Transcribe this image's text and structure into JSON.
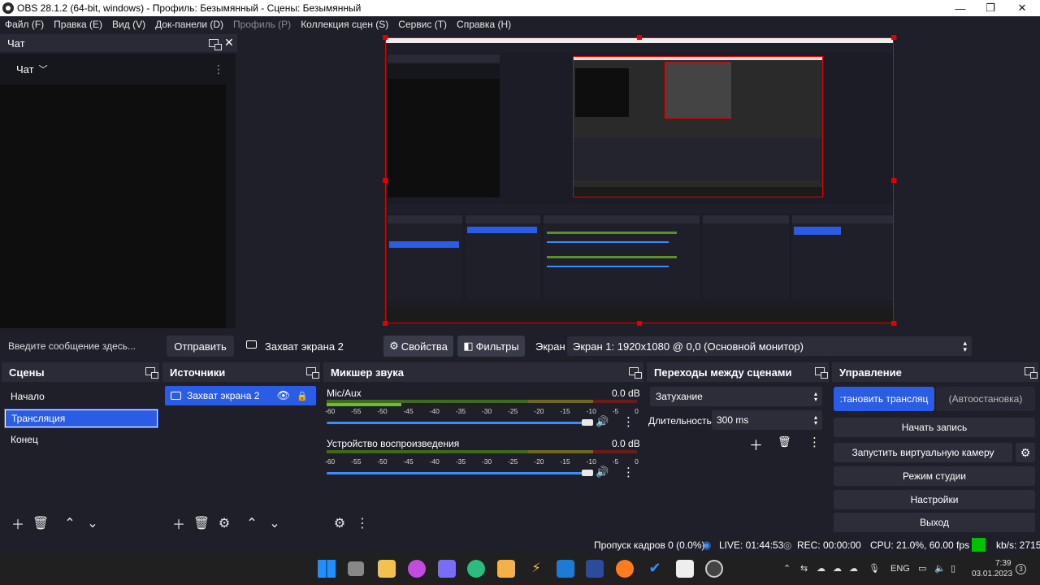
{
  "window": {
    "title": "OBS 28.1.2 (64-bit, windows) - Профиль: Безымянный - Сцены: Безымянный",
    "minimize_icon": "minimize-icon",
    "maximize_icon": "maximize-icon",
    "close_icon": "close-icon"
  },
  "menu": {
    "items": [
      {
        "label": "Файл (F)",
        "enabled": true
      },
      {
        "label": "Правка (E)",
        "enabled": true
      },
      {
        "label": "Вид (V)",
        "enabled": true
      },
      {
        "label": "Док-панели (D)",
        "enabled": true
      },
      {
        "label": "Профиль (P)",
        "enabled": false
      },
      {
        "label": "Коллекция сцен (S)",
        "enabled": true
      },
      {
        "label": "Сервис (T)",
        "enabled": true
      },
      {
        "label": "Справка (H)",
        "enabled": true
      }
    ]
  },
  "chat": {
    "dock_title": "Чат",
    "selector_label": "Чат",
    "input_placeholder": "Введите сообщение здесь...",
    "send_label": "Отправить"
  },
  "source_bar": {
    "source_name": "Захват экрана 2",
    "properties_label": "Свойства",
    "filters_label": "Фильтры",
    "display_label": "Экран",
    "display_value": "Экран 1: 1920x1080 @ 0,0 (Основной монитор)"
  },
  "scenes": {
    "title": "Сцены",
    "items": [
      "Начало",
      "Трансляция",
      "Конец"
    ],
    "selected_index": 1
  },
  "sources": {
    "title": "Источники",
    "items": [
      {
        "name": "Захват экрана 2",
        "visible": true,
        "locked": false
      }
    ]
  },
  "mixer": {
    "title": "Микшер звука",
    "ticks": [
      "-60",
      "-55",
      "-50",
      "-45",
      "-40",
      "-35",
      "-30",
      "-25",
      "-20",
      "-15",
      "-10",
      "-5",
      "0"
    ],
    "channels": [
      {
        "name": "Mic/Aux",
        "db": "0.0 dB",
        "volume": 0.98
      },
      {
        "name": "Устройство воспроизведения",
        "db": "0.0 dB",
        "volume": 0.98
      }
    ]
  },
  "transitions": {
    "title": "Переходы между сценами",
    "type": "Затухание",
    "duration_label": "Длительность",
    "duration_value": "300 ms"
  },
  "controls": {
    "title": "Управление",
    "stream_label": ":тановить трансляц",
    "autostop_label": "(Автоостановка)",
    "record_label": "Начать запись",
    "virtual_cam_label": "Запустить виртуальную камеру",
    "studio_label": "Режим студии",
    "settings_label": "Настройки",
    "exit_label": "Выход"
  },
  "status": {
    "dropped": "Пропуск кадров 0 (0.0%)",
    "live": "LIVE: 01:44:53",
    "rec": "REC: 00:00:00",
    "cpu": "CPU: 21.0%, 60.00 fps",
    "kbs": "kb/s: 2715"
  },
  "taskbar": {
    "lang": "ENG",
    "time": "7:39",
    "date": "03.01.2023",
    "notif_count": "3"
  },
  "colors": {
    "accent": "#2b5ce6",
    "live_green": "#00c000",
    "selection_border": "#e00000"
  }
}
